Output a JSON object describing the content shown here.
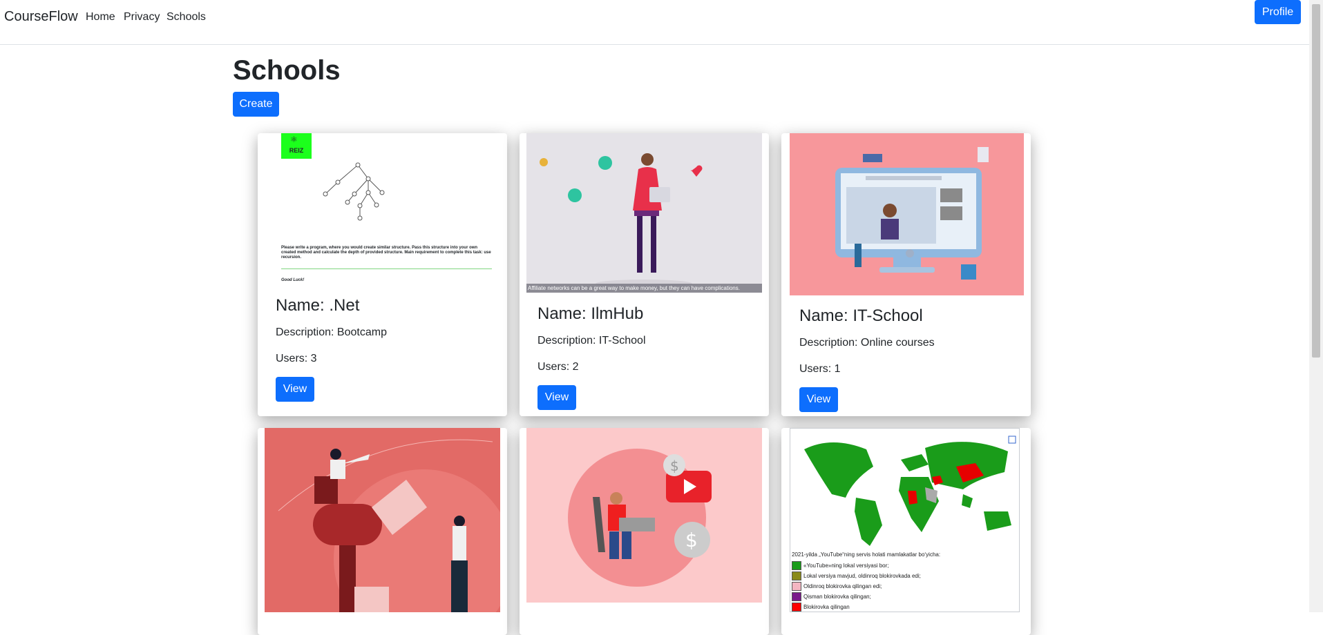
{
  "nav": {
    "brand": "CourseFlow",
    "links": [
      "Home",
      "Privacy",
      "Schools"
    ],
    "profile": "Profile"
  },
  "page": {
    "title": "Schools",
    "create": "Create"
  },
  "cards": [
    {
      "name": "Name: .Net",
      "description": "Description: Bootcamp",
      "users": "Users: 3",
      "view": "View",
      "image": {
        "logo_text": "REIZ",
        "task_text": "Please write a program, where you would create similar structure. Pass this structure into your own created method and calculate the depth of provided structure. Main requirement to complete this task: use recursion.",
        "closing": "Good Luck!"
      }
    },
    {
      "name": "Name: IlmHub",
      "description": "Description: IT-School",
      "users": "Users: 2",
      "view": "View",
      "image": {
        "caption": "Affiliate networks can be a great way to make money, but they can have complications."
      }
    },
    {
      "name": "Name: IT-School",
      "description": "Description: Online courses",
      "users": "Users: 1",
      "view": "View",
      "image": {}
    },
    {
      "image": {}
    },
    {
      "image": {}
    },
    {
      "image": {
        "map_title": "2021-yilda „YouTube“ning servis holati mamlakatlar bo‘yicha:",
        "legend": [
          {
            "label": "«YouTube»ning lokal versiyasi bor;",
            "color": "#1a9c1a"
          },
          {
            "label": "Lokal versiya mavjud, oldinroq blokirovkada edi;",
            "color": "#8a8a1a"
          },
          {
            "label": "Oldinroq blokirovka qilingan edi;",
            "color": "#f4b6c2"
          },
          {
            "label": "Qisman blokirovka qilingan;",
            "color": "#7a1a8a"
          },
          {
            "label": "Blokirovka qilingan",
            "color": "#ff0000"
          }
        ]
      }
    }
  ],
  "colors": {
    "primary": "#0d6efd",
    "map_green": "#1a9c1a",
    "map_red": "#e60000"
  }
}
